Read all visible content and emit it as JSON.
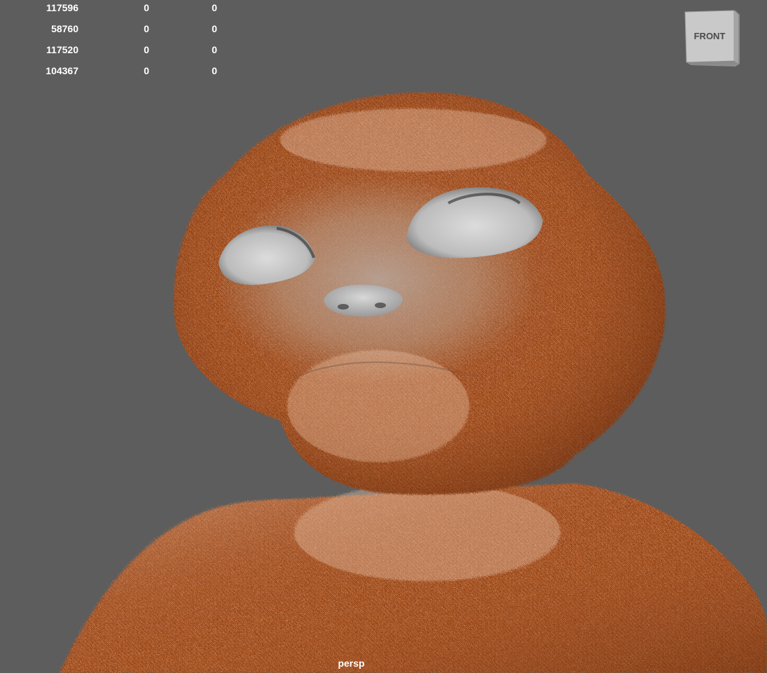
{
  "stats": {
    "rows": [
      [
        "117596",
        "0",
        "0"
      ],
      [
        "58760",
        "0",
        "0"
      ],
      [
        "117520",
        "0",
        "0"
      ],
      [
        "104367",
        "0",
        "0"
      ]
    ]
  },
  "viewcube": {
    "face_label": "FRONT"
  },
  "viewport": {
    "camera_label": "persp",
    "background_color": "#5d5d5d"
  },
  "model": {
    "subject": "furry-creature-render",
    "fur_color": "#a8531f",
    "fur_highlight": "#f3d2bb",
    "eye_color": "#cfcfcf"
  }
}
